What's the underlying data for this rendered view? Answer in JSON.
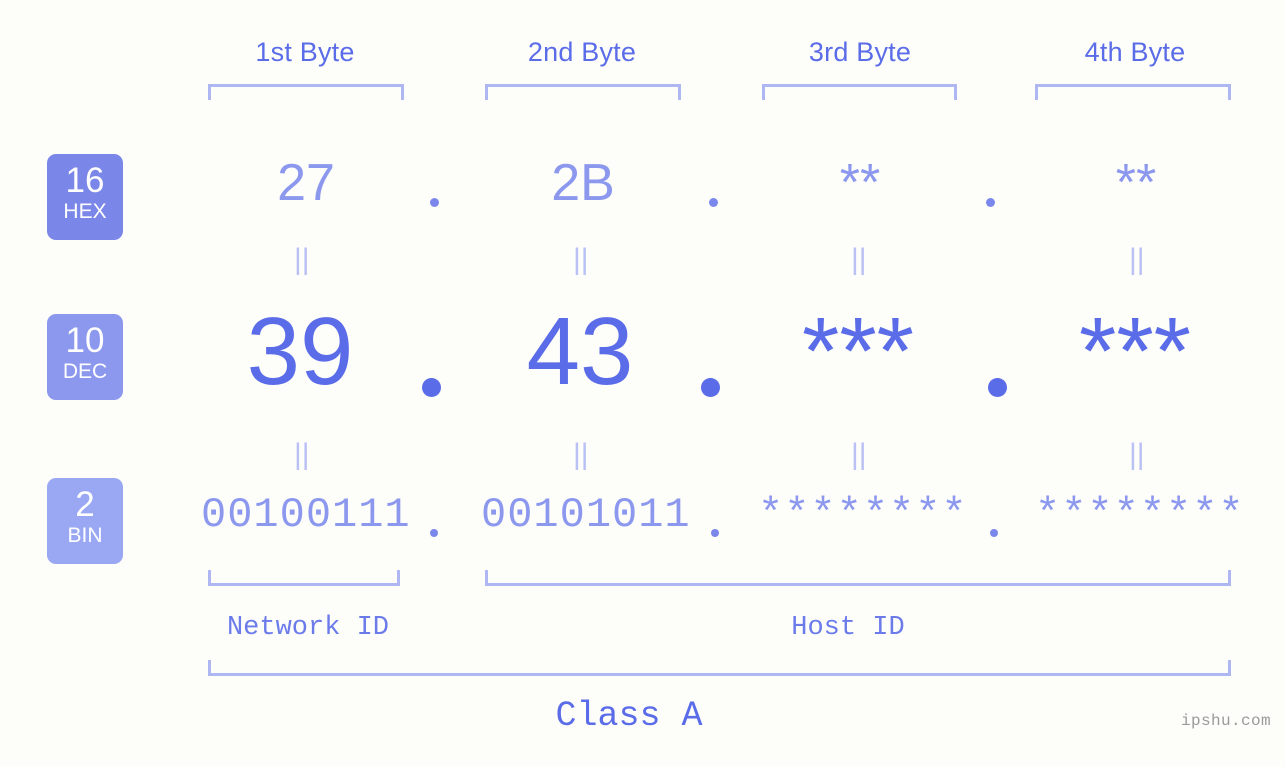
{
  "background_color": "#fdfdfa",
  "accent_colors": {
    "strong": "#5b6ce8",
    "medium": "#8c98ee",
    "light": "#aeb7f2",
    "faint": "#b9c1f5",
    "badge_hex": "#7b87e8",
    "badge_dec": "#8c98ee",
    "badge_bin": "#9aa8f3"
  },
  "header": {
    "byte_labels": [
      "1st Byte",
      "2nd Byte",
      "3rd Byte",
      "4th Byte"
    ]
  },
  "rows": [
    {
      "key": "hex",
      "badge_number": "16",
      "badge_name": "HEX",
      "values": [
        "27",
        "2B",
        "**",
        "**"
      ],
      "separator": "."
    },
    {
      "key": "dec",
      "badge_number": "10",
      "badge_name": "DEC",
      "values": [
        "39",
        "43",
        "***",
        "***"
      ],
      "separator": "."
    },
    {
      "key": "bin",
      "badge_number": "2",
      "badge_name": "BIN",
      "values": [
        "00100111",
        "00101011",
        "********",
        "********"
      ],
      "separator": "."
    }
  ],
  "connectors": {
    "symbol": "||",
    "count_per_gap": 4
  },
  "footer": {
    "network_id_label": "Network ID",
    "host_id_label": "Host ID",
    "class_label": "Class A"
  },
  "watermark": {
    "text": "ipshu.com"
  }
}
